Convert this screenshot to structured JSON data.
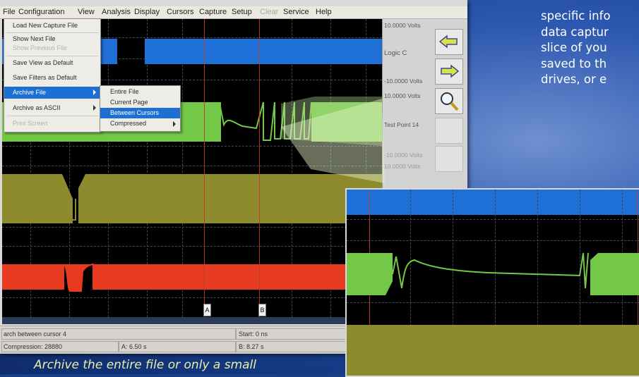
{
  "menu": {
    "items": [
      "File",
      "Configuration",
      "View",
      "Analysis",
      "Display",
      "Cursors",
      "Capture",
      "Setup",
      "Clear",
      "Service",
      "Help"
    ],
    "disabled": [
      "Clear"
    ]
  },
  "file_menu": {
    "items": [
      {
        "label": "Load New Capture File"
      },
      {
        "label": "Show Next File"
      },
      {
        "label": "Show Previous File",
        "disabled": true
      },
      {
        "label": "Save View as Default"
      },
      {
        "label": "Save Filters as Default"
      },
      {
        "label": "Archive File",
        "active": true,
        "submenu": true
      },
      {
        "label": "Archive as ASCII",
        "submenu": true
      },
      {
        "label": "Print Screen",
        "disabled": true
      }
    ]
  },
  "archive_submenu": {
    "items": [
      {
        "label": "Entire File"
      },
      {
        "label": "Current Page"
      },
      {
        "label": "Between Cursors",
        "active": true
      },
      {
        "label": "Compressed",
        "submenu": true
      }
    ]
  },
  "right_panel": {
    "ch1_top": "10.0000 Volts",
    "ch1_name": "Logic C",
    "ch1_bottom": "-10.0000 Volts",
    "ch2_top": "10.0000 Volts",
    "ch2_name": "Test Point 14",
    "ch2_bottom": "-10.0000 Volts",
    "ch3_top": "10.0000 Volts"
  },
  "cursors": {
    "a": "A",
    "b": "B"
  },
  "status": {
    "search": "arch between cursor 4",
    "start": "Start: 0 ns",
    "compression": "Compression: 28880",
    "a_time": "A: 6.50 s",
    "b_time": "B: 8.27 s"
  },
  "marketing_lines": [
    "specific info",
    "data captur",
    "slice of you",
    "saved to th",
    "drives, or e"
  ],
  "caption": "Archive the entire file or only a small",
  "colors": {
    "blue_trace": "#1e6fd6",
    "green_trace": "#74c847",
    "olive_trace": "#8e8a2e",
    "red_trace": "#e83a1e",
    "highlight": "#1d6fd1"
  },
  "icons": [
    "arrow-left-icon",
    "arrow-right-icon",
    "magnifier-icon"
  ]
}
